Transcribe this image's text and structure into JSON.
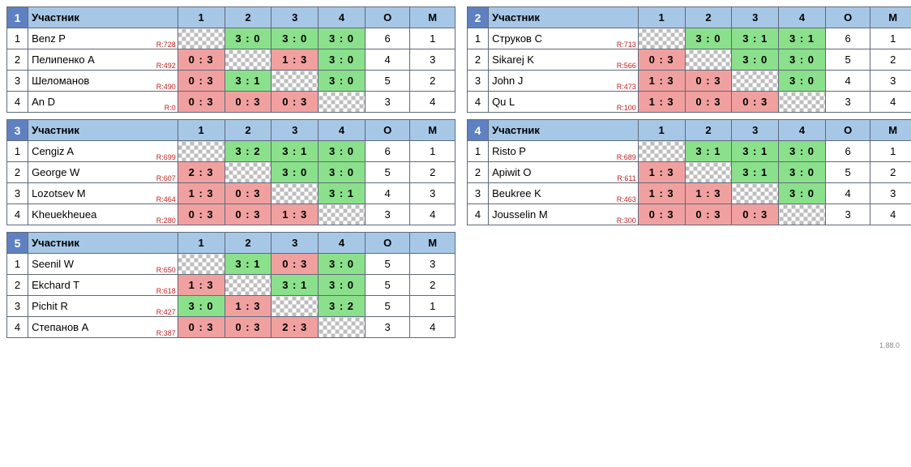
{
  "labels": {
    "participant": "Участник",
    "rounds": [
      "1",
      "2",
      "3",
      "4"
    ],
    "points": "О",
    "place": "М",
    "rating_prefix": "R:"
  },
  "footer": "1.88.0",
  "groups": [
    {
      "number": "1",
      "players": [
        {
          "idx": "1",
          "name": "Benz P",
          "rating": "728",
          "cells": [
            {
              "t": "diag"
            },
            {
              "t": "win",
              "s": "3 : 0"
            },
            {
              "t": "win",
              "s": "3 : 0"
            },
            {
              "t": "win",
              "s": "3 : 0"
            }
          ],
          "points": "6",
          "place": "1"
        },
        {
          "idx": "2",
          "name": "Пелипенко А",
          "rating": "492",
          "cells": [
            {
              "t": "loss",
              "s": "0 : 3"
            },
            {
              "t": "diag"
            },
            {
              "t": "loss",
              "s": "1 : 3"
            },
            {
              "t": "win",
              "s": "3 : 0"
            }
          ],
          "points": "4",
          "place": "3"
        },
        {
          "idx": "3",
          "name": "Шеломанов ",
          "rating": "490",
          "cells": [
            {
              "t": "loss",
              "s": "0 : 3"
            },
            {
              "t": "win",
              "s": "3 : 1"
            },
            {
              "t": "diag"
            },
            {
              "t": "win",
              "s": "3 : 0"
            }
          ],
          "points": "5",
          "place": "2"
        },
        {
          "idx": "4",
          "name": "An D",
          "rating": "0",
          "cells": [
            {
              "t": "loss",
              "s": "0 : 3"
            },
            {
              "t": "loss",
              "s": "0 : 3"
            },
            {
              "t": "loss",
              "s": "0 : 3"
            },
            {
              "t": "diag"
            }
          ],
          "points": "3",
          "place": "4"
        }
      ]
    },
    {
      "number": "2",
      "players": [
        {
          "idx": "1",
          "name": "Струков С",
          "rating": "713",
          "cells": [
            {
              "t": "diag"
            },
            {
              "t": "win",
              "s": "3 : 0"
            },
            {
              "t": "win",
              "s": "3 : 1"
            },
            {
              "t": "win",
              "s": "3 : 1"
            }
          ],
          "points": "6",
          "place": "1"
        },
        {
          "idx": "2",
          "name": "Sikarej K",
          "rating": "566",
          "cells": [
            {
              "t": "loss",
              "s": "0 : 3"
            },
            {
              "t": "diag"
            },
            {
              "t": "win",
              "s": "3 : 0"
            },
            {
              "t": "win",
              "s": "3 : 0"
            }
          ],
          "points": "5",
          "place": "2"
        },
        {
          "idx": "3",
          "name": "John J",
          "rating": "473",
          "cells": [
            {
              "t": "loss",
              "s": "1 : 3"
            },
            {
              "t": "loss",
              "s": "0 : 3"
            },
            {
              "t": "diag"
            },
            {
              "t": "win",
              "s": "3 : 0"
            }
          ],
          "points": "4",
          "place": "3"
        },
        {
          "idx": "4",
          "name": "Qu L",
          "rating": "100",
          "cells": [
            {
              "t": "loss",
              "s": "1 : 3"
            },
            {
              "t": "loss",
              "s": "0 : 3"
            },
            {
              "t": "loss",
              "s": "0 : 3"
            },
            {
              "t": "diag"
            }
          ],
          "points": "3",
          "place": "4"
        }
      ]
    },
    {
      "number": "3",
      "players": [
        {
          "idx": "1",
          "name": "Cengiz A",
          "rating": "699",
          "cells": [
            {
              "t": "diag"
            },
            {
              "t": "win",
              "s": "3 : 2"
            },
            {
              "t": "win",
              "s": "3 : 1"
            },
            {
              "t": "win",
              "s": "3 : 0"
            }
          ],
          "points": "6",
          "place": "1"
        },
        {
          "idx": "2",
          "name": "George W",
          "rating": "607",
          "cells": [
            {
              "t": "loss",
              "s": "2 : 3"
            },
            {
              "t": "diag"
            },
            {
              "t": "win",
              "s": "3 : 0"
            },
            {
              "t": "win",
              "s": "3 : 0"
            }
          ],
          "points": "5",
          "place": "2"
        },
        {
          "idx": "3",
          "name": "Lozotsev M",
          "rating": "464",
          "cells": [
            {
              "t": "loss",
              "s": "1 : 3"
            },
            {
              "t": "loss",
              "s": "0 : 3"
            },
            {
              "t": "diag"
            },
            {
              "t": "win",
              "s": "3 : 1"
            }
          ],
          "points": "4",
          "place": "3"
        },
        {
          "idx": "4",
          "name": "Kheuekheuea",
          "rating": "280",
          "cells": [
            {
              "t": "loss",
              "s": "0 : 3"
            },
            {
              "t": "loss",
              "s": "0 : 3"
            },
            {
              "t": "loss",
              "s": "1 : 3"
            },
            {
              "t": "diag"
            }
          ],
          "points": "3",
          "place": "4"
        }
      ]
    },
    {
      "number": "4",
      "players": [
        {
          "idx": "1",
          "name": "Risto P",
          "rating": "689",
          "cells": [
            {
              "t": "diag"
            },
            {
              "t": "win",
              "s": "3 : 1"
            },
            {
              "t": "win",
              "s": "3 : 1"
            },
            {
              "t": "win",
              "s": "3 : 0"
            }
          ],
          "points": "6",
          "place": "1"
        },
        {
          "idx": "2",
          "name": "Apiwit O",
          "rating": "611",
          "cells": [
            {
              "t": "loss",
              "s": "1 : 3"
            },
            {
              "t": "diag"
            },
            {
              "t": "win",
              "s": "3 : 1"
            },
            {
              "t": "win",
              "s": "3 : 0"
            }
          ],
          "points": "5",
          "place": "2"
        },
        {
          "idx": "3",
          "name": "Beukree K",
          "rating": "463",
          "cells": [
            {
              "t": "loss",
              "s": "1 : 3"
            },
            {
              "t": "loss",
              "s": "1 : 3"
            },
            {
              "t": "diag"
            },
            {
              "t": "win",
              "s": "3 : 0"
            }
          ],
          "points": "4",
          "place": "3"
        },
        {
          "idx": "4",
          "name": "Jousselin M",
          "rating": "300",
          "cells": [
            {
              "t": "loss",
              "s": "0 : 3"
            },
            {
              "t": "loss",
              "s": "0 : 3"
            },
            {
              "t": "loss",
              "s": "0 : 3"
            },
            {
              "t": "diag"
            }
          ],
          "points": "3",
          "place": "4"
        }
      ]
    },
    {
      "number": "5",
      "players": [
        {
          "idx": "1",
          "name": "Seenil W",
          "rating": "650",
          "cells": [
            {
              "t": "diag"
            },
            {
              "t": "win",
              "s": "3 : 1"
            },
            {
              "t": "loss",
              "s": "0 : 3"
            },
            {
              "t": "win",
              "s": "3 : 0"
            }
          ],
          "points": "5",
          "place": "3"
        },
        {
          "idx": "2",
          "name": "Ekchard T",
          "rating": "618",
          "cells": [
            {
              "t": "loss",
              "s": "1 : 3"
            },
            {
              "t": "diag"
            },
            {
              "t": "win",
              "s": "3 : 1"
            },
            {
              "t": "win",
              "s": "3 : 0"
            }
          ],
          "points": "5",
          "place": "2"
        },
        {
          "idx": "3",
          "name": "Pichit R",
          "rating": "427",
          "cells": [
            {
              "t": "win",
              "s": "3 : 0"
            },
            {
              "t": "loss",
              "s": "1 : 3"
            },
            {
              "t": "diag"
            },
            {
              "t": "win",
              "s": "3 : 2"
            }
          ],
          "points": "5",
          "place": "1"
        },
        {
          "idx": "4",
          "name": "Степанов А",
          "rating": "387",
          "cells": [
            {
              "t": "loss",
              "s": "0 : 3"
            },
            {
              "t": "loss",
              "s": "0 : 3"
            },
            {
              "t": "loss",
              "s": "2 : 3"
            },
            {
              "t": "diag"
            }
          ],
          "points": "3",
          "place": "4"
        }
      ]
    }
  ]
}
